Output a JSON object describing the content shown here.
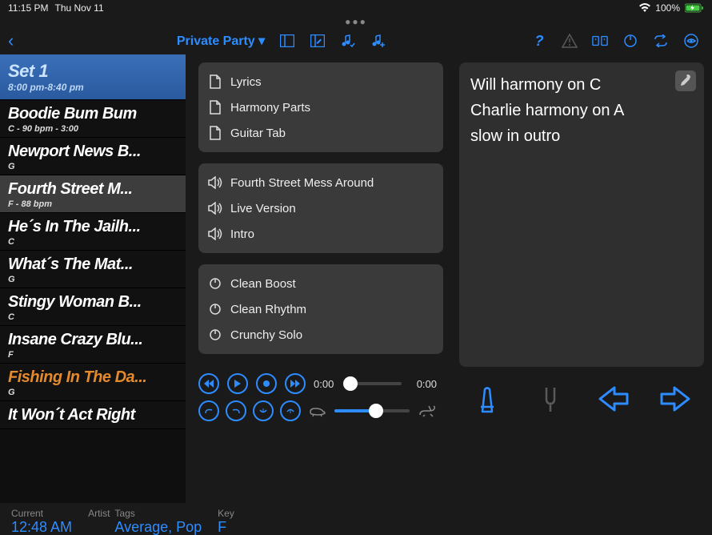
{
  "status": {
    "time": "11:15 PM",
    "date": "Thu Nov 11",
    "battery": "100%"
  },
  "toolbar": {
    "title": "Private Party ▾"
  },
  "set": {
    "title": "Set 1",
    "subtitle": "8:00 pm-8:40 pm"
  },
  "songs": [
    {
      "title": "Boodie Bum Bum",
      "sub": "C - 90 bpm - 3:00",
      "selected": false
    },
    {
      "title": "Newport News B...",
      "sub": "G",
      "selected": false
    },
    {
      "title": "Fourth Street M...",
      "sub": "F - 88 bpm",
      "selected": true
    },
    {
      "title": "He´s In The Jailh...",
      "sub": "C",
      "selected": false
    },
    {
      "title": "What´s The Mat...",
      "sub": "G",
      "selected": false
    },
    {
      "title": "Stingy Woman B...",
      "sub": "C",
      "selected": false
    },
    {
      "title": "Insane Crazy Blu...",
      "sub": "F",
      "selected": false
    },
    {
      "title": "Fishing In The Da...",
      "sub": "G",
      "selected": false,
      "orange": true
    },
    {
      "title": "It Won´t Act Right",
      "sub": "",
      "selected": false
    }
  ],
  "docs": [
    {
      "label": "Lyrics"
    },
    {
      "label": "Harmony Parts"
    },
    {
      "label": "Guitar Tab"
    }
  ],
  "recordings": [
    {
      "label": "Fourth Street Mess Around"
    },
    {
      "label": "Live Version"
    },
    {
      "label": "Intro"
    }
  ],
  "presets": [
    {
      "label": "Clean Boost"
    },
    {
      "label": "Clean Rhythm"
    },
    {
      "label": "Crunchy Solo"
    }
  ],
  "notes": "Will harmony on C\nCharlie harmony on A\nslow in outro",
  "transport": {
    "pos": "0:00",
    "dur": "0:00",
    "tempo_fill": 55
  },
  "footer": {
    "current_label": "Current",
    "current_val": "12:48 AM",
    "artist_label": "Artist",
    "tags_label": "Tags",
    "tags_val": "Average, Pop",
    "key_label": "Key",
    "key_val": "F"
  }
}
